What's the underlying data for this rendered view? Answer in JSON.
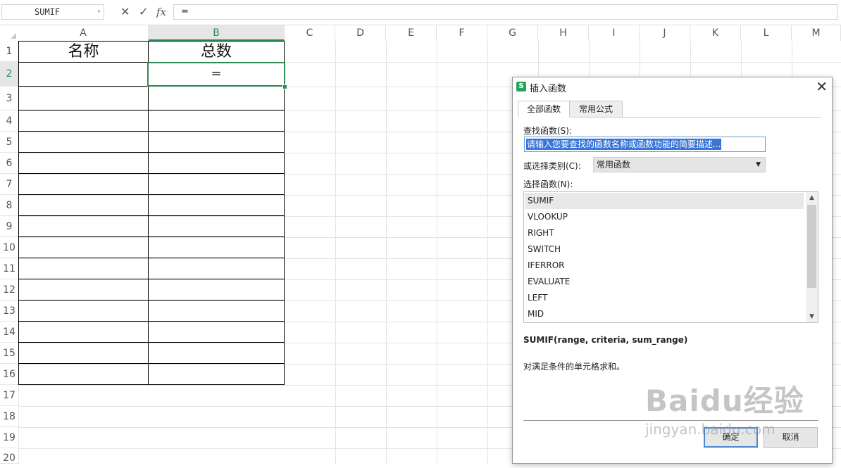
{
  "formula_bar": {
    "name_box": "SUMIF",
    "cancel_icon": "✕",
    "confirm_icon": "✓",
    "fx_label": "fx",
    "formula": "="
  },
  "columns": [
    "A",
    "B",
    "C",
    "D",
    "E",
    "F",
    "G",
    "H",
    "I",
    "J",
    "K",
    "L",
    "M"
  ],
  "rows": [
    "1",
    "2",
    "3",
    "4",
    "5",
    "6",
    "7",
    "8",
    "9",
    "10",
    "11",
    "12",
    "13",
    "14",
    "15",
    "16",
    "17",
    "18",
    "19",
    "20"
  ],
  "cells": {
    "A1": "名称",
    "B1": "总数",
    "B2": "="
  },
  "selected_cell": "B2",
  "dialog": {
    "title": "插入函数",
    "logo": "S",
    "close": "✕",
    "tabs": [
      "全部函数",
      "常用公式"
    ],
    "search_label": "查找函数(S):",
    "search_value": "请输入您要查找的函数名称或函数功能的简要描述...",
    "category_label": "或选择类别(C):",
    "category_value": "常用函数",
    "category_arrow": "▼",
    "function_label": "选择函数(N):",
    "functions": [
      "SUMIF",
      "VLOOKUP",
      "RIGHT",
      "SWITCH",
      "IFERROR",
      "EVALUATE",
      "LEFT",
      "MID"
    ],
    "selected_function": "SUMIF",
    "scroll_up": "▲",
    "scroll_down": "▼",
    "signature": "SUMIF(range, criteria, sum_range)",
    "description": "对满足条件的单元格求和。",
    "ok_label": "确定",
    "cancel_label": "取消"
  },
  "watermark": {
    "brand": "Baidu经验",
    "url": "jingyan.baidu.com"
  }
}
